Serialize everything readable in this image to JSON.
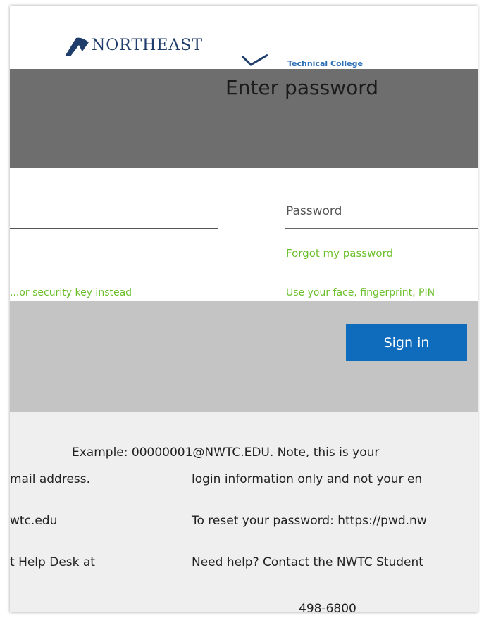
{
  "brand": {
    "name": "NORTHEAST",
    "subtitle": "Technical College"
  },
  "form": {
    "title": "Enter password",
    "password_placeholder": "Password",
    "forgot_link": "Forgot my password",
    "alt_left_fragment": "...or security key instead",
    "alt_right_fragment": "Use your face, fingerprint, PIN"
  },
  "actions": {
    "sign_in": "Sign in"
  },
  "info": {
    "example": "Example: 00000001@NWTC.EDU. Note, this is your",
    "left_email": "mail address.",
    "right_login": "login information only and not your en",
    "left_domain": "wtc.edu",
    "right_reset": "To reset your password: https://pwd.nw",
    "left_help": "t Help Desk at",
    "right_help": "Need help? Contact the NWTC Student",
    "phone": "498-6800"
  },
  "colors": {
    "accent_green": "#6bbf2a",
    "button_blue": "#0f6cbd",
    "band_grey": "#6e6e6e"
  }
}
